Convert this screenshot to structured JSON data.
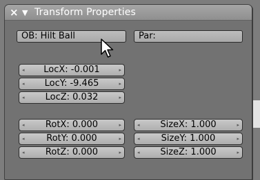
{
  "panel": {
    "title": "Transform Properties",
    "close_icon": "×",
    "collapse_icon": "▼"
  },
  "object_field": {
    "value": "OB: Hilt Ball"
  },
  "parent_field": {
    "value": "Par:"
  },
  "location": [
    {
      "label": "LocX: -0.001"
    },
    {
      "label": "LocY: -9.465"
    },
    {
      "label": "LocZ: 0.032"
    }
  ],
  "rotation": [
    {
      "label": "RotX: 0.000"
    },
    {
      "label": "RotY: 0.000"
    },
    {
      "label": "RotZ: 0.000"
    }
  ],
  "size": [
    {
      "label": "SizeX: 1.000"
    },
    {
      "label": "SizeY: 1.000"
    },
    {
      "label": "SizeZ: 1.000"
    }
  ],
  "arrow_left": "◂",
  "arrow_right": "▸",
  "cursor_icon": "mouse-pointer-icon"
}
